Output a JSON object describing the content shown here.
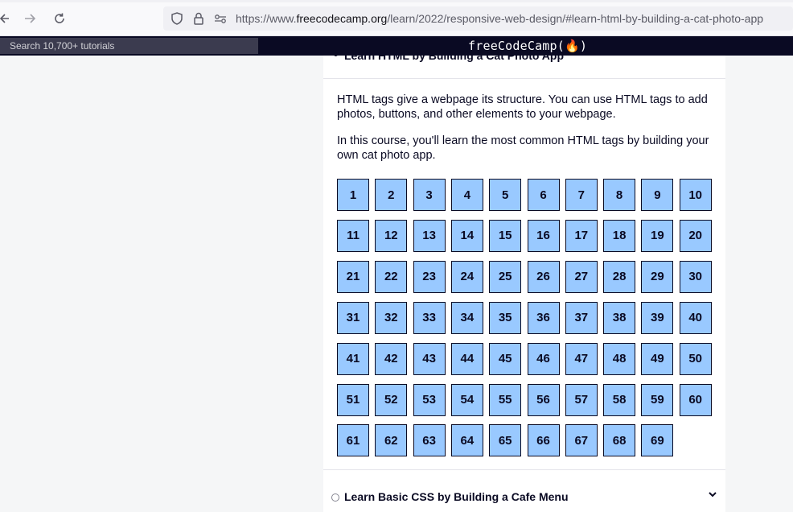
{
  "browser": {
    "url_prefix": "https://www.",
    "url_domain": "freecodecamp.org",
    "url_path": "/learn/2022/responsive-web-design/#learn-html-by-building-a-cat-photo-app",
    "back_icon": "back-arrow-icon",
    "forward_icon": "forward-arrow-icon",
    "reload_icon": "reload-icon"
  },
  "fcc_nav": {
    "search_placeholder": "Search 10,700+ tutorials",
    "logo_text": "freeCodeCamp(🔥)"
  },
  "course": {
    "current_title": "Learn HTML by Building a Cat Photo App",
    "description_1": "HTML tags give a webpage its structure. You can use HTML tags to add photos, buttons, and other elements to your webpage.",
    "description_2": "In this course, you'll learn the most common HTML tags by building your own cat photo app.",
    "steps": [
      "1",
      "2",
      "3",
      "4",
      "5",
      "6",
      "7",
      "8",
      "9",
      "10",
      "11",
      "12",
      "13",
      "14",
      "15",
      "16",
      "17",
      "18",
      "19",
      "20",
      "21",
      "22",
      "23",
      "24",
      "25",
      "26",
      "27",
      "28",
      "29",
      "30",
      "31",
      "32",
      "33",
      "34",
      "35",
      "36",
      "37",
      "38",
      "39",
      "40",
      "41",
      "42",
      "43",
      "44",
      "45",
      "46",
      "47",
      "48",
      "49",
      "50",
      "51",
      "52",
      "53",
      "54",
      "55",
      "56",
      "57",
      "58",
      "59",
      "60",
      "61",
      "62",
      "63",
      "64",
      "65",
      "66",
      "67",
      "68",
      "69"
    ]
  },
  "next_course": {
    "title": "Learn Basic CSS by Building a Cafe Menu",
    "chevron": "⌄"
  },
  "colors": {
    "step_fill": "#99c9ff",
    "nav_bg": "#0a0a23"
  }
}
